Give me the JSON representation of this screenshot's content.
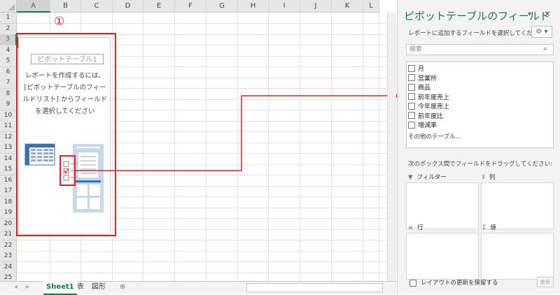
{
  "columns": [
    "A",
    "B",
    "C",
    "D",
    "E",
    "F",
    "G",
    "H",
    "I",
    "J",
    "K",
    "L"
  ],
  "rows": [
    "1",
    "2",
    "3",
    "4",
    "5",
    "6",
    "7",
    "8",
    "9",
    "10",
    "11",
    "12",
    "13",
    "14",
    "15",
    "16",
    "17",
    "18",
    "19",
    "20",
    "21",
    "22",
    "23",
    "24",
    "25"
  ],
  "pivot": {
    "name": "ピボットテーブル1",
    "instruction": "レポートを作成するには、[ピボットテーブルのフィールドリスト] からフィールドを選択してください"
  },
  "annotations": {
    "one": "①",
    "two": "②"
  },
  "tabs": [
    "Sheet1",
    "表",
    "図形"
  ],
  "add_sheet": "⊕",
  "panel": {
    "title": "ピボットテーブルのフィールド",
    "subtitle": "レポートに追加するフィールドを選択してください:",
    "search_placeholder": "検索",
    "fields": [
      "月",
      "営業所",
      "商品",
      "前年度売上",
      "今年度売上",
      "前年度比",
      "増減率"
    ],
    "more_tables": "その他のテーブル...",
    "drag_label": "次のボックス間でフィールドをドラッグしてください:",
    "areas": {
      "filter": "フィルター",
      "columns": "列",
      "rows": "行",
      "values": "値"
    },
    "defer_label": "レイアウトの更新を保留する",
    "update_button": "更新"
  },
  "colors": {
    "accent": "#217346",
    "annotation_red": "#e31e24",
    "illustration_blue": "#3e6fb4"
  }
}
